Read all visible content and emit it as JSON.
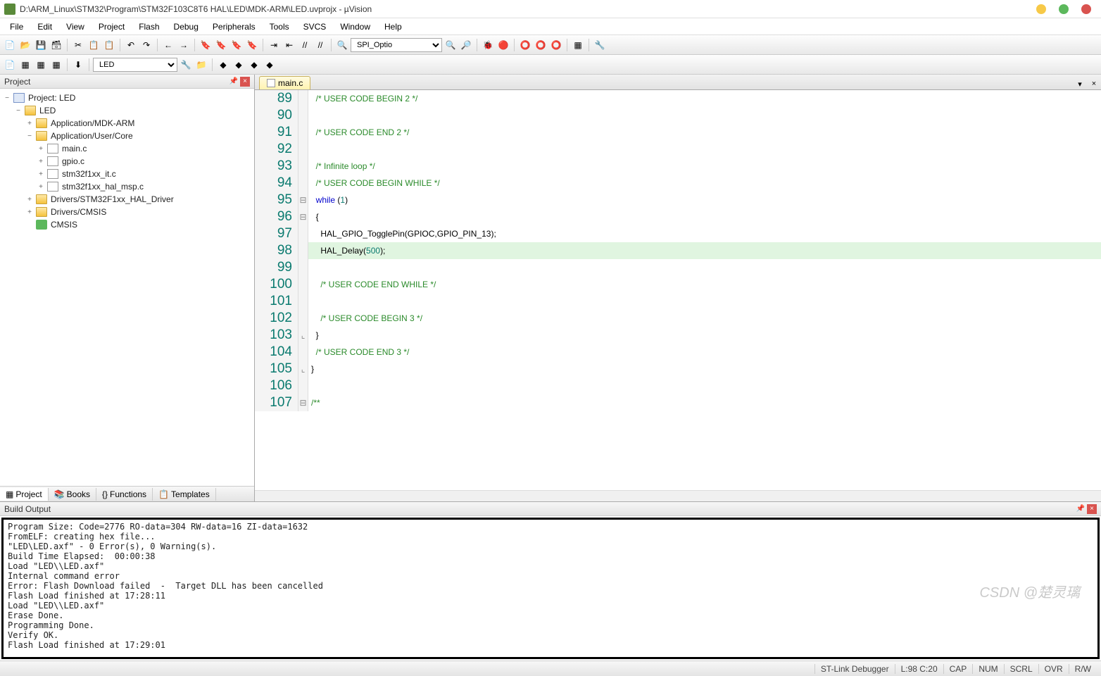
{
  "titlebar": {
    "title": "D:\\ARM_Linux\\STM32\\Program\\STM32F103C8T6 HAL\\LED\\MDK-ARM\\LED.uvprojx - µVision"
  },
  "menu": [
    "File",
    "Edit",
    "View",
    "Project",
    "Flash",
    "Debug",
    "Peripherals",
    "Tools",
    "SVCS",
    "Window",
    "Help"
  ],
  "toolbar2_target": "LED",
  "toolbar1_combo": "SPI_Optio",
  "project_panel": {
    "title": "Project",
    "root": "Project: LED",
    "items": [
      {
        "depth": 1,
        "label": "LED",
        "twist": "−",
        "icon": "folder"
      },
      {
        "depth": 2,
        "label": "Application/MDK-ARM",
        "twist": "+",
        "icon": "folder"
      },
      {
        "depth": 2,
        "label": "Application/User/Core",
        "twist": "−",
        "icon": "folder"
      },
      {
        "depth": 3,
        "label": "main.c",
        "twist": "+",
        "icon": "file"
      },
      {
        "depth": 3,
        "label": "gpio.c",
        "twist": "+",
        "icon": "file"
      },
      {
        "depth": 3,
        "label": "stm32f1xx_it.c",
        "twist": "+",
        "icon": "file"
      },
      {
        "depth": 3,
        "label": "stm32f1xx_hal_msp.c",
        "twist": "+",
        "icon": "file"
      },
      {
        "depth": 2,
        "label": "Drivers/STM32F1xx_HAL_Driver",
        "twist": "+",
        "icon": "folder"
      },
      {
        "depth": 2,
        "label": "Drivers/CMSIS",
        "twist": "+",
        "icon": "folder"
      },
      {
        "depth": 2,
        "label": "CMSIS",
        "twist": "",
        "icon": "cmsis"
      }
    ],
    "tabs": [
      "Project",
      "Books",
      "Functions",
      "Templates"
    ]
  },
  "editor": {
    "tab": "main.c",
    "lines": [
      {
        "n": 89,
        "html": "  <span class='c-comment'>/* USER CODE BEGIN 2 */</span>"
      },
      {
        "n": 90,
        "html": ""
      },
      {
        "n": 91,
        "html": "  <span class='c-comment'>/* USER CODE END 2 */</span>"
      },
      {
        "n": 92,
        "html": ""
      },
      {
        "n": 93,
        "html": "  <span class='c-comment'>/* Infinite loop */</span>"
      },
      {
        "n": 94,
        "html": "  <span class='c-comment'>/* USER CODE BEGIN WHILE */</span>"
      },
      {
        "n": 95,
        "html": "  <span class='c-kw'>while</span> (<span class='c-num'>1</span>)",
        "fold": "⊟"
      },
      {
        "n": 96,
        "html": "  {",
        "fold": "⊟"
      },
      {
        "n": 97,
        "html": "    HAL_GPIO_TogglePin(GPIOC,GPIO_PIN_13);"
      },
      {
        "n": 98,
        "html": "    HAL_Delay(<span class='c-num'>500</span>);",
        "hl": true
      },
      {
        "n": 99,
        "html": ""
      },
      {
        "n": 100,
        "html": "    <span class='c-comment'>/* USER CODE END WHILE */</span>"
      },
      {
        "n": 101,
        "html": ""
      },
      {
        "n": 102,
        "html": "    <span class='c-comment'>/* USER CODE BEGIN 3 */</span>"
      },
      {
        "n": 103,
        "html": "  }",
        "fold": "⌞"
      },
      {
        "n": 104,
        "html": "  <span class='c-comment'>/* USER CODE END 3 */</span>"
      },
      {
        "n": 105,
        "html": "}",
        "fold": "⌞"
      },
      {
        "n": 106,
        "html": ""
      },
      {
        "n": 107,
        "html": "<span class='c-comment'>/**</span>",
        "fold": "⊟"
      }
    ]
  },
  "build_output": {
    "title": "Build Output",
    "lines": [
      "Program Size: Code=2776 RO-data=304 RW-data=16 ZI-data=1632",
      "FromELF: creating hex file...",
      "\"LED\\LED.axf\" - 0 Error(s), 0 Warning(s).",
      "Build Time Elapsed:  00:00:38",
      "Load \"LED\\\\LED.axf\"",
      "Internal command error",
      "Error: Flash Download failed  -  Target DLL has been cancelled",
      "Flash Load finished at 17:28:11",
      "Load \"LED\\\\LED.axf\"",
      "Erase Done.",
      "Programming Done.",
      "Verify OK.",
      "Flash Load finished at 17:29:01"
    ]
  },
  "status": {
    "debugger": "ST-Link Debugger",
    "cursor": "L:98 C:20",
    "caps": "CAP",
    "num": "NUM",
    "scrl": "SCRL",
    "ovr": "OVR",
    "rw": "R/W"
  }
}
